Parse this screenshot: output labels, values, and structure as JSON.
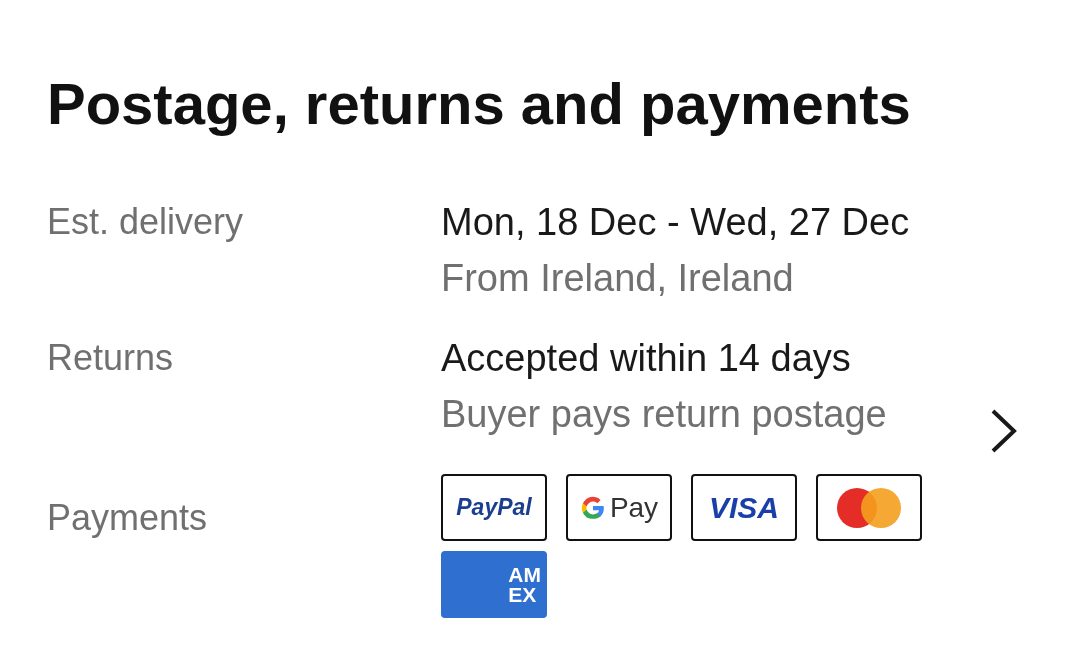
{
  "heading": "Postage, returns and payments",
  "rows": [
    {
      "label": "Est. delivery",
      "primary": "Mon, 18 Dec - Wed, 27 Dec",
      "secondary": "From Ireland, Ireland",
      "chevron": false
    },
    {
      "label": "Returns",
      "primary": "Accepted within 14 days",
      "secondary": "Buyer pays return postage",
      "chevron": true
    }
  ],
  "payments": {
    "label": "Payments",
    "methods": [
      {
        "kind": "paypal",
        "lines": [
          "PayPal"
        ]
      },
      {
        "kind": "gpay",
        "lines": [
          "Pay"
        ]
      },
      {
        "kind": "visa",
        "lines": [
          "VISA"
        ]
      },
      {
        "kind": "mastercard"
      },
      {
        "kind": "amex",
        "lines": [
          "AM",
          "EX"
        ]
      }
    ]
  }
}
